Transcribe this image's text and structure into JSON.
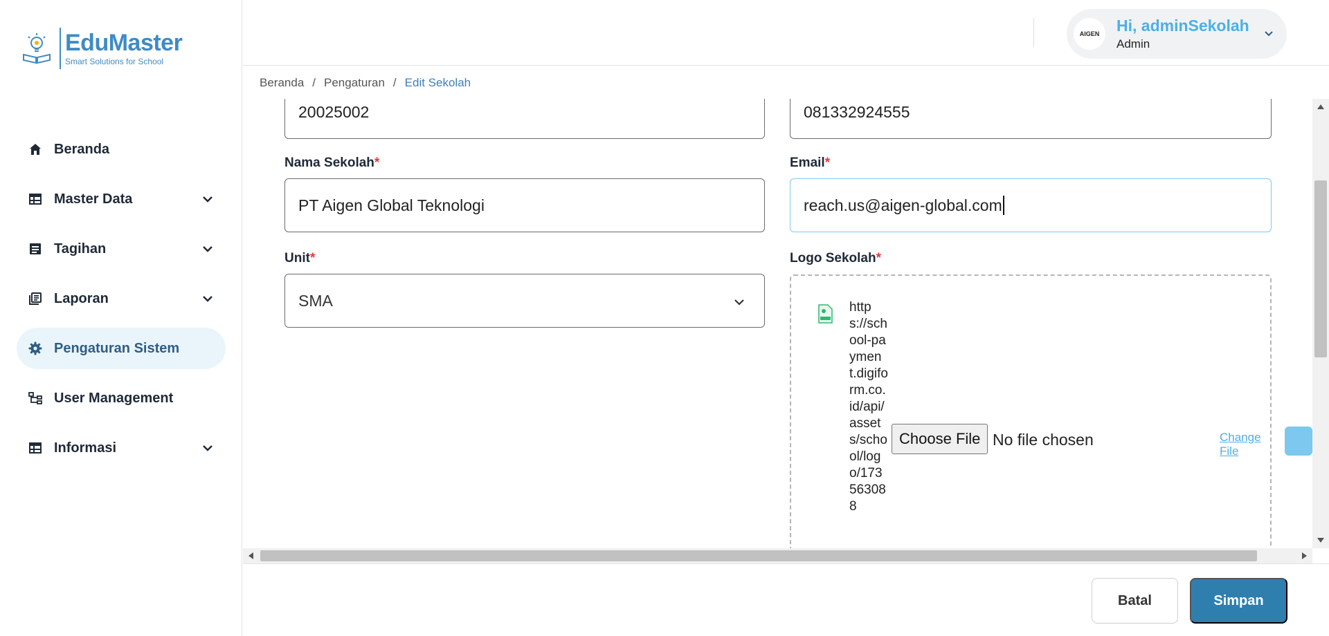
{
  "brand": {
    "name": "EduMaster",
    "tagline": "Smart Solutions for School",
    "color": "#3f8bc5"
  },
  "sidebar": {
    "items": [
      {
        "label": "Beranda",
        "icon": "home-icon",
        "has_submenu": false,
        "active": false
      },
      {
        "label": "Master Data",
        "icon": "table-icon",
        "has_submenu": true,
        "active": false
      },
      {
        "label": "Tagihan",
        "icon": "list-icon",
        "has_submenu": true,
        "active": false
      },
      {
        "label": "Laporan",
        "icon": "library-icon",
        "has_submenu": true,
        "active": false
      },
      {
        "label": "Pengaturan Sistem",
        "icon": "gear-icon",
        "has_submenu": false,
        "active": true
      },
      {
        "label": "User Management",
        "icon": "hierarchy-icon",
        "has_submenu": false,
        "active": false
      },
      {
        "label": "Informasi",
        "icon": "table-icon",
        "has_submenu": true,
        "active": false
      }
    ]
  },
  "header": {
    "greeting": "Hi, adminSekolah",
    "role": "Admin",
    "avatar_text": "AIGEN"
  },
  "breadcrumb": {
    "items": [
      "Beranda",
      "Pengaturan",
      "Edit Sekolah"
    ],
    "separator": "/"
  },
  "form": {
    "npsn_value": "20025002",
    "phone_value": "081332924555",
    "nama_sekolah": {
      "label": "Nama Sekolah",
      "value": "PT Aigen Global Teknologi"
    },
    "email": {
      "label": "Email",
      "value": "reach.us@aigen-global.com"
    },
    "unit": {
      "label": "Unit",
      "value": "SMA"
    },
    "logo": {
      "label": "Logo Sekolah",
      "url_text": "https://school-payment.digiform.co.id/api/assets/school/logo/173563088",
      "choose_label": "Choose File",
      "no_file_text": "No file chosen",
      "change_label": "Change File"
    },
    "required_mark": "*"
  },
  "footer": {
    "cancel_label": "Batal",
    "save_label": "Simpan"
  },
  "colors": {
    "accent": "#2f7fae",
    "active_bg": "#eaf5fb",
    "required": "#e53935",
    "greeting": "#4bb0e6"
  }
}
